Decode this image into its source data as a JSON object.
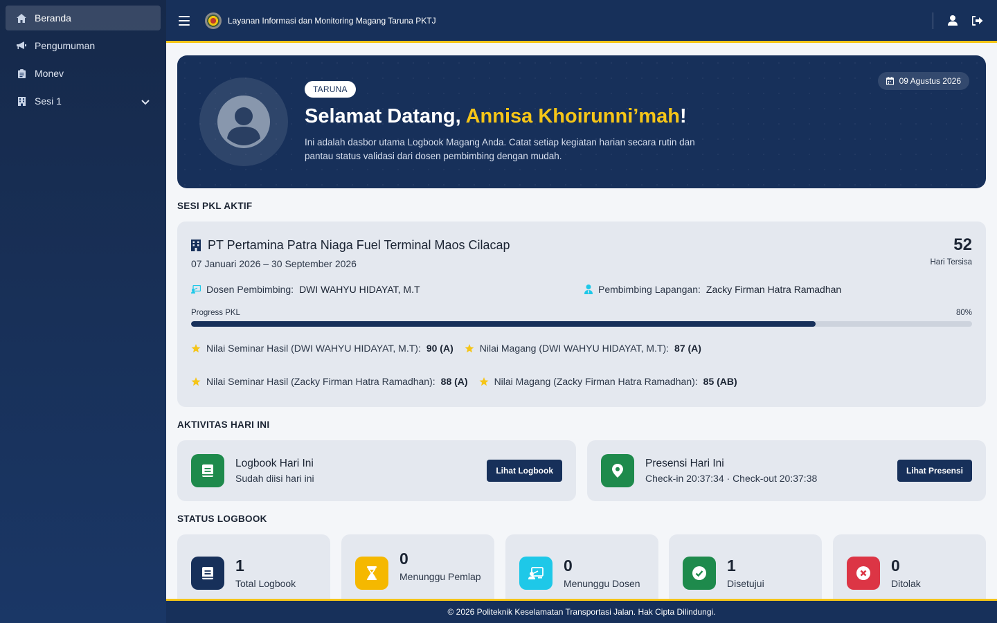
{
  "sidebar": {
    "items": [
      {
        "label": "Beranda",
        "icon": "home-icon"
      },
      {
        "label": "Pengumuman",
        "icon": "megaphone-icon"
      },
      {
        "label": "Monev",
        "icon": "clipboard-icon"
      },
      {
        "label": "Sesi 1",
        "icon": "building-icon"
      }
    ]
  },
  "topbar": {
    "title": "Layanan Informasi dan Monitoring Magang Taruna PKTJ"
  },
  "hero": {
    "badge": "TARUNA",
    "greeting": "Selamat Datang, ",
    "name": "Annisa Khoirunni’mah",
    "exclaim": "!",
    "description": "Ini adalah dasbor utama Logbook Magang Anda. Catat setiap kegiatan harian secara rutin dan pantau status validasi dari dosen pembimbing dengan mudah.",
    "date": "09 Agustus 2026"
  },
  "sections": {
    "pkl": "SESI PKL AKTIF",
    "activity": "AKTIVITAS HARI INI",
    "status": "STATUS LOGBOOK"
  },
  "pkl": {
    "company": "PT Pertamina Patra Niaga Fuel Terminal Maos Cilacap",
    "period": "07 Januari 2026 – 30 September 2026",
    "days_left": "52",
    "days_left_label": "Hari Tersisa",
    "dosen_label": "Dosen Pembimbing:",
    "dosen_name": "DWI WAHYU HIDAYAT, M.T",
    "lapangan_label": "Pembimbing Lapangan:",
    "lapangan_name": "Zacky Firman Hatra Ramadhan",
    "progress_label": "Progress PKL",
    "progress_text": "80%",
    "progress_value": 80,
    "grades": [
      {
        "label": "Nilai Seminar Hasil (DWI WAHYU HIDAYAT, M.T):",
        "value": "90 (A)"
      },
      {
        "label": "Nilai Magang (DWI WAHYU HIDAYAT, M.T):",
        "value": "87 (A)"
      },
      {
        "label": "Nilai Seminar Hasil (Zacky Firman Hatra Ramadhan):",
        "value": "88 (A)"
      },
      {
        "label": "Nilai Magang (Zacky Firman Hatra Ramadhan):",
        "value": "85 (AB)"
      }
    ]
  },
  "activity": {
    "logbook": {
      "title": "Logbook Hari Ini",
      "subtitle": "Sudah diisi hari ini",
      "button": "Lihat Logbook"
    },
    "presensi": {
      "title": "Presensi Hari Ini",
      "subtitle": "Check-in 20:37:34 · Check-out 20:37:38",
      "button": "Lihat Presensi"
    }
  },
  "stats": [
    {
      "value": "1",
      "label": "Total Logbook",
      "color": "#17305a",
      "icon": "book-icon"
    },
    {
      "value": "0",
      "label": "Menunggu Pemlap",
      "color": "#f5b800",
      "icon": "hourglass-icon"
    },
    {
      "value": "0",
      "label": "Menunggu Dosen",
      "color": "#1ec8e8",
      "icon": "teacher-icon"
    },
    {
      "value": "1",
      "label": "Disetujui",
      "color": "#1e8a4c",
      "icon": "check-circle-icon"
    },
    {
      "value": "0",
      "label": "Ditolak",
      "color": "#dc3545",
      "icon": "x-circle-icon"
    }
  ],
  "footer": {
    "text": "© 2026 Politeknik Keselamatan Transportasi Jalan. Hak Cipta Dilindungi."
  },
  "colors": {
    "primary": "#17305a",
    "accent": "#f5c518",
    "success": "#1e8a4c"
  }
}
